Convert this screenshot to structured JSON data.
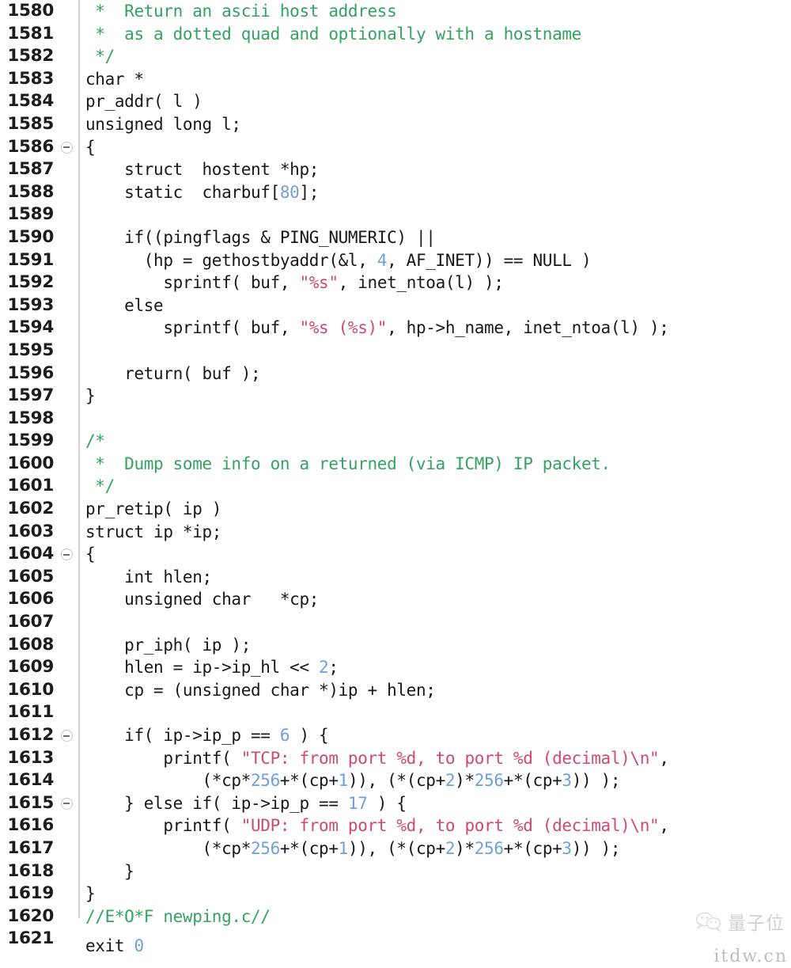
{
  "editor": {
    "gutter_divider": true,
    "first_line_number": 1580,
    "last_line_number": 1621,
    "colors": {
      "background": "#ffffff",
      "foreground": "#18181a",
      "comment": "#34a263",
      "string": "#cf4a6e",
      "number": "#6f9fdc",
      "line_number": "#1c1c1e",
      "gutter_rule": "#d2d2d4",
      "fold_marker": "#c6c6c8"
    },
    "fold_marker_label": "collapse-minus",
    "lines": [
      {
        "n": "1580",
        "fold": false,
        "tokens": [
          {
            "t": " *  Return an ascii host address",
            "c": "cmt"
          }
        ]
      },
      {
        "n": "1581",
        "fold": false,
        "tokens": [
          {
            "t": " *  as a dotted quad and optionally with a hostname",
            "c": "cmt"
          }
        ]
      },
      {
        "n": "1582",
        "fold": false,
        "tokens": [
          {
            "t": " */",
            "c": "cmt"
          }
        ]
      },
      {
        "n": "1583",
        "fold": false,
        "tokens": [
          {
            "t": "char *",
            "c": ""
          }
        ]
      },
      {
        "n": "1584",
        "fold": false,
        "tokens": [
          {
            "t": "pr_addr( l )",
            "c": ""
          }
        ]
      },
      {
        "n": "1585",
        "fold": false,
        "tokens": [
          {
            "t": "unsigned long l;",
            "c": ""
          }
        ]
      },
      {
        "n": "1586",
        "fold": true,
        "tokens": [
          {
            "t": "{",
            "c": ""
          }
        ]
      },
      {
        "n": "1587",
        "fold": false,
        "tokens": [
          {
            "t": "    struct  hostent *hp;",
            "c": ""
          }
        ]
      },
      {
        "n": "1588",
        "fold": false,
        "tokens": [
          {
            "t": "    static  charbuf[",
            "c": ""
          },
          {
            "t": "80",
            "c": "num"
          },
          {
            "t": "];",
            "c": ""
          }
        ]
      },
      {
        "n": "1589",
        "fold": false,
        "tokens": []
      },
      {
        "n": "1590",
        "fold": false,
        "tokens": [
          {
            "t": "    if((pingflags & PING_NUMERIC) ||",
            "c": ""
          }
        ]
      },
      {
        "n": "1591",
        "fold": false,
        "tokens": [
          {
            "t": "      (hp = gethostbyaddr(&l, ",
            "c": ""
          },
          {
            "t": "4",
            "c": "num"
          },
          {
            "t": ", AF_INET)) == NULL )",
            "c": ""
          }
        ]
      },
      {
        "n": "1592",
        "fold": false,
        "tokens": [
          {
            "t": "        sprintf( buf, ",
            "c": ""
          },
          {
            "t": "\"%s\"",
            "c": "str"
          },
          {
            "t": ", inet_ntoa(l) );",
            "c": ""
          }
        ]
      },
      {
        "n": "1593",
        "fold": false,
        "tokens": [
          {
            "t": "    else",
            "c": ""
          }
        ]
      },
      {
        "n": "1594",
        "fold": false,
        "tokens": [
          {
            "t": "        sprintf( buf, ",
            "c": ""
          },
          {
            "t": "\"%s (%s)\"",
            "c": "str"
          },
          {
            "t": ", hp->h_name, inet_ntoa(l) );",
            "c": ""
          }
        ]
      },
      {
        "n": "1595",
        "fold": false,
        "tokens": []
      },
      {
        "n": "1596",
        "fold": false,
        "tokens": [
          {
            "t": "    return( buf );",
            "c": ""
          }
        ]
      },
      {
        "n": "1597",
        "fold": false,
        "tokens": [
          {
            "t": "}",
            "c": ""
          }
        ]
      },
      {
        "n": "1598",
        "fold": false,
        "tokens": []
      },
      {
        "n": "1599",
        "fold": false,
        "tokens": [
          {
            "t": "/*",
            "c": "cmt"
          }
        ]
      },
      {
        "n": "1600",
        "fold": false,
        "tokens": [
          {
            "t": " *  Dump some info on a returned (via ICMP) IP packet.",
            "c": "cmt"
          }
        ]
      },
      {
        "n": "1601",
        "fold": false,
        "tokens": [
          {
            "t": " */",
            "c": "cmt"
          }
        ]
      },
      {
        "n": "1602",
        "fold": false,
        "tokens": [
          {
            "t": "pr_retip( ip )",
            "c": ""
          }
        ]
      },
      {
        "n": "1603",
        "fold": false,
        "tokens": [
          {
            "t": "struct ip *ip;",
            "c": ""
          }
        ]
      },
      {
        "n": "1604",
        "fold": true,
        "tokens": [
          {
            "t": "{",
            "c": ""
          }
        ]
      },
      {
        "n": "1605",
        "fold": false,
        "tokens": [
          {
            "t": "    int hlen;",
            "c": ""
          }
        ]
      },
      {
        "n": "1606",
        "fold": false,
        "tokens": [
          {
            "t": "    unsigned char   *cp;",
            "c": ""
          }
        ]
      },
      {
        "n": "1607",
        "fold": false,
        "tokens": []
      },
      {
        "n": "1608",
        "fold": false,
        "tokens": [
          {
            "t": "    pr_iph( ip );",
            "c": ""
          }
        ]
      },
      {
        "n": "1609",
        "fold": false,
        "tokens": [
          {
            "t": "    hlen = ip->ip_hl << ",
            "c": ""
          },
          {
            "t": "2",
            "c": "num"
          },
          {
            "t": ";",
            "c": ""
          }
        ]
      },
      {
        "n": "1610",
        "fold": false,
        "tokens": [
          {
            "t": "    cp = (unsigned char *)ip + hlen;",
            "c": ""
          }
        ]
      },
      {
        "n": "1611",
        "fold": false,
        "tokens": []
      },
      {
        "n": "1612",
        "fold": true,
        "tokens": [
          {
            "t": "    if( ip->ip_p == ",
            "c": ""
          },
          {
            "t": "6",
            "c": "num"
          },
          {
            "t": " ) {",
            "c": ""
          }
        ]
      },
      {
        "n": "1613",
        "fold": false,
        "tokens": [
          {
            "t": "        printf( ",
            "c": ""
          },
          {
            "t": "\"TCP: from port %d, to port %d (decimal)\\n\"",
            "c": "str"
          },
          {
            "t": ",",
            "c": ""
          }
        ]
      },
      {
        "n": "1614",
        "fold": false,
        "tokens": [
          {
            "t": "            (*cp*",
            "c": ""
          },
          {
            "t": "256",
            "c": "num"
          },
          {
            "t": "+*(cp+",
            "c": ""
          },
          {
            "t": "1",
            "c": "num"
          },
          {
            "t": ")), (*(cp+",
            "c": ""
          },
          {
            "t": "2",
            "c": "num"
          },
          {
            "t": ")*",
            "c": ""
          },
          {
            "t": "256",
            "c": "num"
          },
          {
            "t": "+*(cp+",
            "c": ""
          },
          {
            "t": "3",
            "c": "num"
          },
          {
            "t": ")) );",
            "c": ""
          }
        ]
      },
      {
        "n": "1615",
        "fold": true,
        "tokens": [
          {
            "t": "    } else if( ip->ip_p == ",
            "c": ""
          },
          {
            "t": "17",
            "c": "num"
          },
          {
            "t": " ) {",
            "c": ""
          }
        ]
      },
      {
        "n": "1616",
        "fold": false,
        "tokens": [
          {
            "t": "        printf( ",
            "c": ""
          },
          {
            "t": "\"UDP: from port %d, to port %d (decimal)\\n\"",
            "c": "str"
          },
          {
            "t": ",",
            "c": ""
          }
        ]
      },
      {
        "n": "1617",
        "fold": false,
        "tokens": [
          {
            "t": "            (*cp*",
            "c": ""
          },
          {
            "t": "256",
            "c": "num"
          },
          {
            "t": "+*(cp+",
            "c": ""
          },
          {
            "t": "1",
            "c": "num"
          },
          {
            "t": ")), (*(cp+",
            "c": ""
          },
          {
            "t": "2",
            "c": "num"
          },
          {
            "t": ")*",
            "c": ""
          },
          {
            "t": "256",
            "c": "num"
          },
          {
            "t": "+*(cp+",
            "c": ""
          },
          {
            "t": "3",
            "c": "num"
          },
          {
            "t": ")) );",
            "c": ""
          }
        ]
      },
      {
        "n": "1618",
        "fold": false,
        "tokens": [
          {
            "t": "    }",
            "c": ""
          }
        ]
      },
      {
        "n": "1619",
        "fold": false,
        "tokens": [
          {
            "t": "}",
            "c": ""
          }
        ]
      },
      {
        "n": "1620",
        "fold": false,
        "tokens": [
          {
            "t": "//E*O*F newping.c//",
            "c": "cmt"
          }
        ]
      },
      {
        "n": "1621",
        "fold": false,
        "tokens": []
      }
    ],
    "trailing": [
      {
        "t": "exit ",
        "c": ""
      },
      {
        "t": "0",
        "c": "num"
      }
    ]
  },
  "watermark": {
    "icon": "wechat-icon",
    "name": "量子位",
    "url": "itdw.cn"
  }
}
